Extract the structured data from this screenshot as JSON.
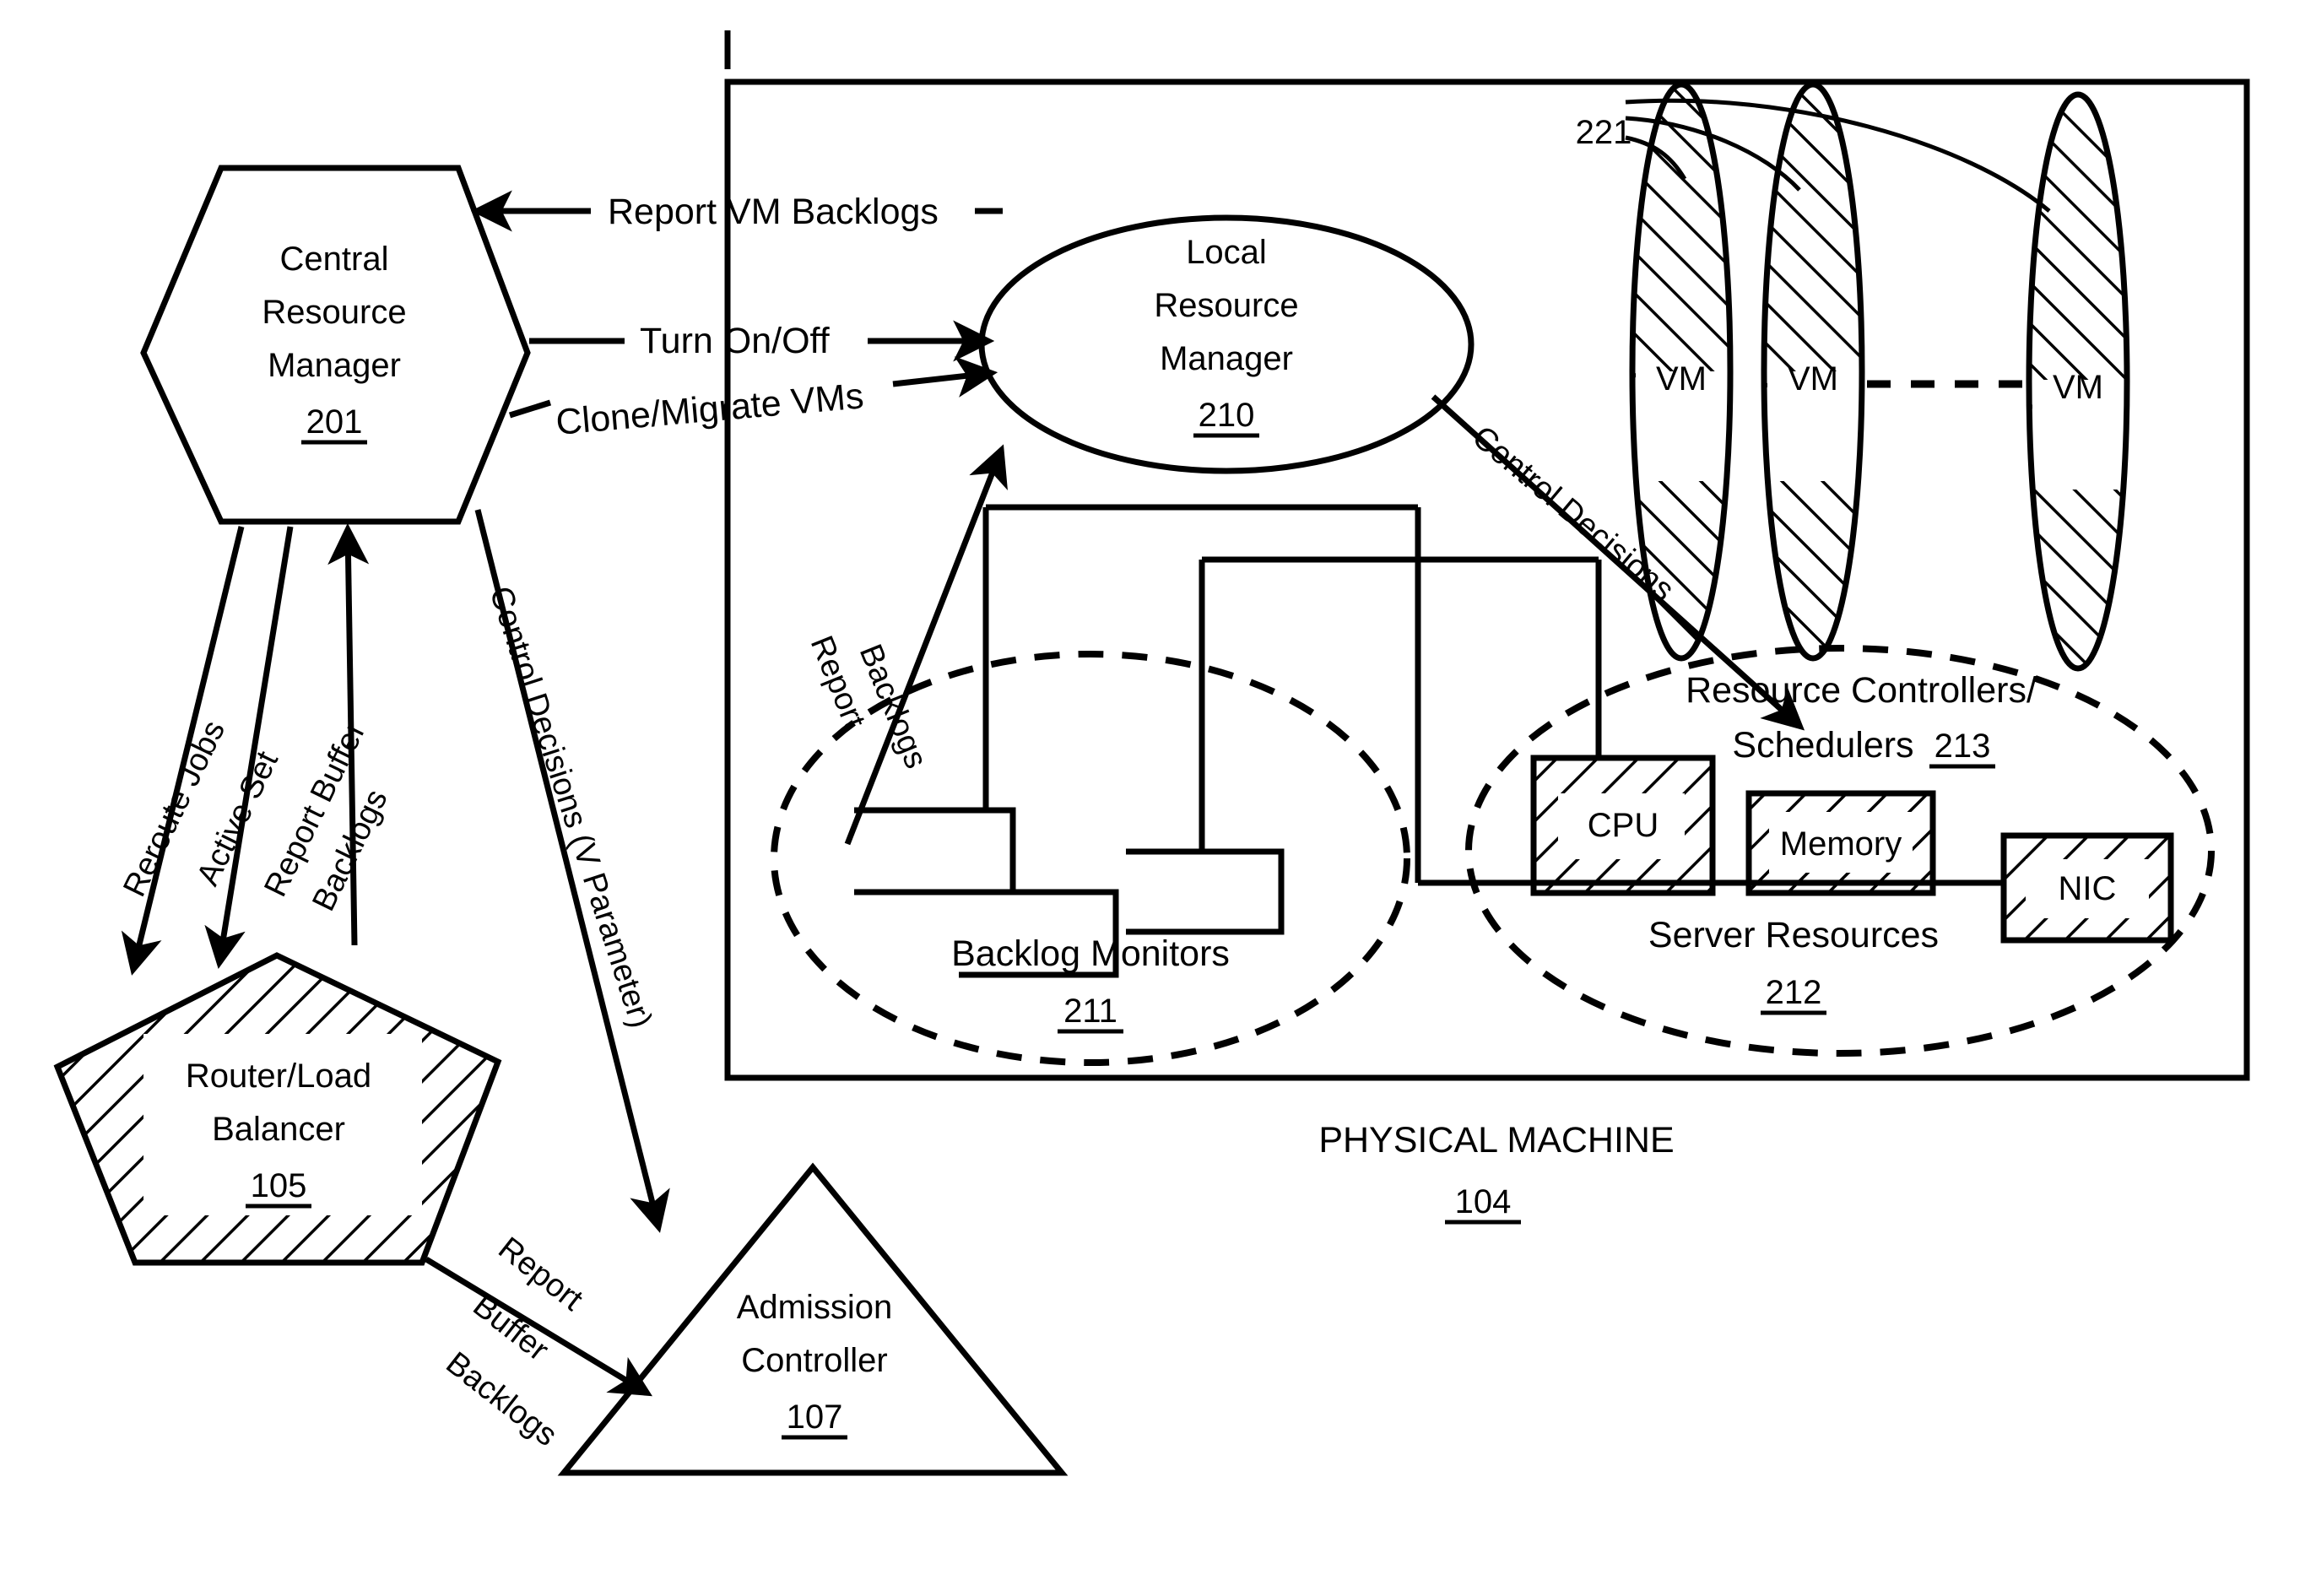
{
  "figure": {
    "title": "Resource management architecture for a physical machine with virtual machines"
  },
  "nodes": {
    "central_resource_manager": {
      "line1": "Central",
      "line2": "Resource",
      "line3": "Manager",
      "ref": "201"
    },
    "local_resource_manager": {
      "line1": "Local",
      "line2": "Resource",
      "line3": "Manager",
      "ref": "210"
    },
    "router_load_balancer": {
      "line1": "Router/Load",
      "line2": "Balancer",
      "ref": "105"
    },
    "admission_controller": {
      "line1": "Admission",
      "line2": "Controller",
      "ref": "107"
    },
    "backlog_monitors": {
      "label": "Backlog Monitors",
      "ref": "211"
    },
    "server_resources": {
      "label": "Server Resources",
      "ref": "212"
    },
    "resource_controllers": {
      "line1": "Resource Controllers/",
      "line2": "Schedulers",
      "ref": "213"
    },
    "physical_machine": {
      "label": "PHYSICAL MACHINE",
      "ref": "104"
    },
    "vm_group": {
      "ref": "221",
      "vms": [
        "VM",
        "VM",
        "VM"
      ]
    },
    "resources": {
      "cpu": "CPU",
      "memory": "Memory",
      "nic": "NIC"
    }
  },
  "edges": {
    "report_vm_backlogs": "Report VM Backlogs",
    "turn_on_off": "Turn On/Off",
    "clone_migrate_vms": "Clone/Migrate VMs",
    "reroute_jobs": "Reroute Jobs",
    "active_set": "Active Set",
    "report_buffer_backlogs_1": "Report Buffer",
    "report_buffer_backlogs_2": "Backlogs",
    "control_decisions_v": "Control Decisions (V Parameter)",
    "report_backlogs_1": "Report",
    "report_backlogs_2": "Backlogs",
    "control_decisions": "Control Decisions",
    "report_buffer_backlogs_lb_1": "Report",
    "report_buffer_backlogs_lb_2": "Buffer",
    "report_buffer_backlogs_lb_3": "Backlogs"
  },
  "colors": {
    "ink": "#000000",
    "paper": "#ffffff"
  }
}
